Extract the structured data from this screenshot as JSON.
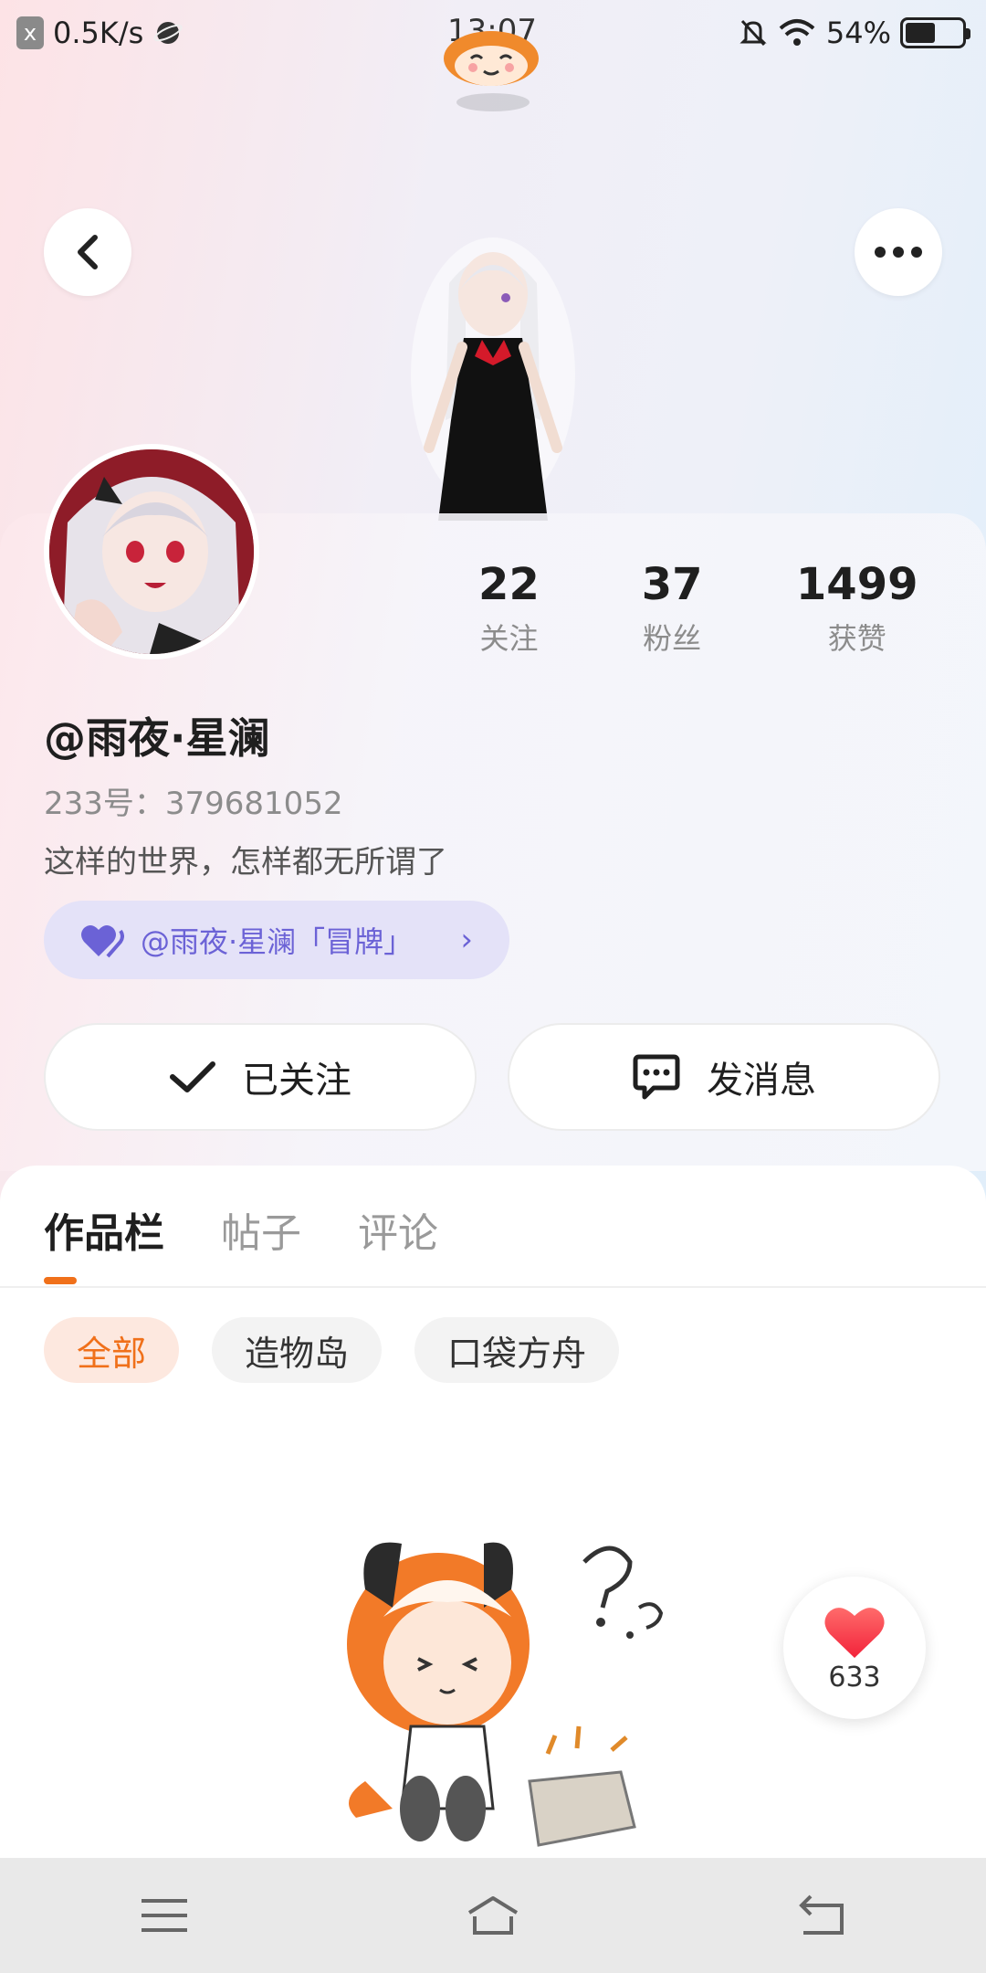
{
  "status_bar": {
    "close_badge": "x",
    "network_speed": "0.5K/s",
    "time": "13:07",
    "battery_percent": "54%",
    "battery_level": 0.54
  },
  "header": {
    "back_icon": "chevron-left-icon",
    "more_icon": "more-horizontal-icon"
  },
  "profile": {
    "stats": [
      {
        "value": "22",
        "label": "关注"
      },
      {
        "value": "37",
        "label": "粉丝"
      },
      {
        "value": "1499",
        "label": "获赞"
      }
    ],
    "nickname": "@雨夜·星澜",
    "uid": "233号：379681052",
    "bio": "这样的世界，怎样都无所谓了",
    "fan_badge": "@雨夜·星澜「冒牌」",
    "follow_button": "已关注",
    "message_button": "发消息"
  },
  "content": {
    "tabs": [
      "作品栏",
      "帖子",
      "评论"
    ],
    "active_tab": 0,
    "chips": [
      "全部",
      "造物岛",
      "口袋方舟"
    ],
    "active_chip": 0,
    "like_count": "633"
  },
  "nav_bar": {
    "icons": [
      "menu-icon",
      "home-icon",
      "back-icon"
    ]
  },
  "colors": {
    "accent_orange": "#f0701a",
    "badge_purple": "#6b62d6"
  }
}
